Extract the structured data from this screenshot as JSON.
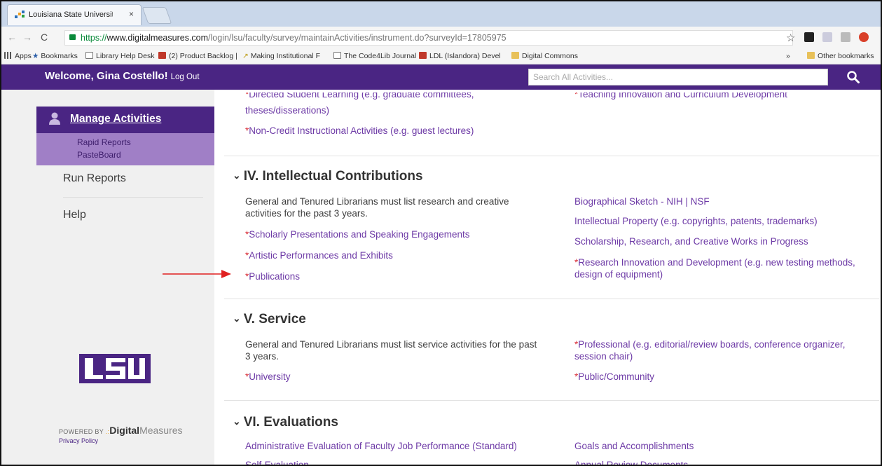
{
  "browser": {
    "tab_title": "Louisiana State Universit",
    "tab_close": "×",
    "url_https": "https://",
    "url_host": "www.digitalmeasures.com",
    "url_path": "/login/lsu/faculty/survey/maintainActivities/instrument.do?surveyId=17805975",
    "bookmarks": [
      {
        "label": "Apps",
        "icon": "apps-icon"
      },
      {
        "label": "Bookmarks",
        "icon": "star-icon"
      },
      {
        "label": "Library Help Desk",
        "icon": "page-icon"
      },
      {
        "label": "(2) Product Backlog |",
        "icon": "trello-icon"
      },
      {
        "label": "Making Institutional F",
        "icon": "link-icon"
      },
      {
        "label": "The Code4Lib Journal",
        "icon": "code4lib-icon"
      },
      {
        "label": "LDL (Islandora) Devel",
        "icon": "trello-icon"
      },
      {
        "label": "Digital Commons",
        "icon": "folder-icon"
      },
      {
        "label": "»",
        "icon": ""
      },
      {
        "label": "Other bookmarks",
        "icon": "folder-icon"
      }
    ]
  },
  "header": {
    "welcome": "Welcome, Gina Costello!",
    "logout": "Log Out",
    "search_placeholder": "Search All Activities..."
  },
  "sidebar": {
    "manage": "Manage Activities",
    "rapid_reports": "Rapid Reports",
    "pasteboard": "PasteBoard",
    "run_reports": "Run Reports",
    "help": "Help",
    "logo": "LSU",
    "powered_by": "POWERED BY",
    "powered_brand_bold": "Digital",
    "powered_brand_light": "Measures",
    "privacy": "Privacy Policy"
  },
  "top_partial": {
    "left_cut": "Directed Student Learning (e.g. graduate committees,",
    "left_cont": "theses/disserations)",
    "left_2": "Non-Credit Instructional Activities (e.g. guest lectures)",
    "right_cut": "Teaching Innovation and Curriculum Development"
  },
  "sections": {
    "iv": {
      "title": "IV. Intellectual Contributions",
      "note_1": "General and Tenured Librarians must list research and creative",
      "note_2": "activities for the past 3 years.",
      "scholarly": "Scholarly Presentations and Speaking Engagements",
      "artistic": "Artistic Performances and Exhibits",
      "publications": "Publications",
      "bio_label": "Biographical Sketch - ",
      "bio_nih": "NIH",
      "bio_sep": " | ",
      "bio_nsf": "NSF",
      "ip": "Intellectual Property (e.g. copyrights, patents, trademarks)",
      "scholarship": "Scholarship, Research, and Creative Works in Progress",
      "rid_1": "Research Innovation and Development (e.g. new testing methods,",
      "rid_2": "design of equipment)"
    },
    "v": {
      "title": "V. Service",
      "note_1": "General and Tenured Librarians must list service activities for the past",
      "note_2": "3 years.",
      "university": "University",
      "prof_1": "Professional (e.g. editorial/review boards, conference organizer,",
      "prof_2": "session chair)",
      "public": "Public/Community"
    },
    "vi": {
      "title": "VI. Evaluations",
      "admin_eval": "Administrative Evaluation of Faculty Job Performance (Standard)",
      "self_eval": "Self-Evaluation",
      "goals": "Goals and Accomplishments",
      "annual": "Annual Review Documents"
    }
  },
  "required_marker": "*",
  "chevron": "⌄",
  "colors": {
    "header_purple": "#4a2583",
    "subnav_purple": "#a07fc6",
    "link_purple": "#6d3aa6",
    "required_red": "#d9313a",
    "annotation_arrow": "#e02020"
  }
}
